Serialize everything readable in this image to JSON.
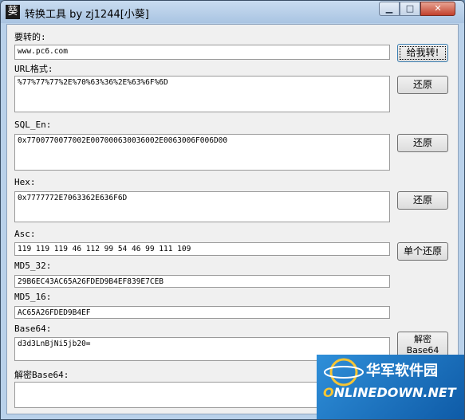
{
  "window": {
    "icon_glyph": "葵",
    "title": "转换工具 by zj1244[小葵]",
    "minimize_glyph": "▁",
    "maximize_glyph": "□",
    "close_glyph": "✕"
  },
  "fields": {
    "input": {
      "label": "要转的:",
      "value": "www.pc6.com"
    },
    "url": {
      "label": "URL格式:",
      "value": "%77%77%77%2E%70%63%36%2E%63%6F%6D"
    },
    "sql_en": {
      "label": "SQL_En:",
      "value": "0x7700770077002E007000630036002E0063006F006D00"
    },
    "hex": {
      "label": "Hex:",
      "value": "0x7777772E7063362E636F6D"
    },
    "asc": {
      "label": "Asc:",
      "value": "119 119 119 46 112 99 54 46 99 111 109"
    },
    "md5_32": {
      "label": "MD5_32:",
      "value": "29B6EC43AC65A26FDED9B4EF839E7CEB"
    },
    "md5_16": {
      "label": "MD5_16:",
      "value": "AC65A26FDED9B4EF"
    },
    "base64": {
      "label": "Base64:",
      "value": "d3d3LnBjNi5jb20="
    },
    "decode_base64": {
      "label": "解密Base64:",
      "value": ""
    }
  },
  "buttons": {
    "convert": "给我转!",
    "restore_url": "还原",
    "restore_sql": "还原",
    "restore_hex": "还原",
    "restore_single": "单个还原",
    "decrypt_line1": "解密",
    "decrypt_line2": "Base64"
  },
  "watermark": {
    "cn": "华军软件园",
    "en_prefix": "O",
    "en_rest": "NLINEDOWN.NET"
  }
}
